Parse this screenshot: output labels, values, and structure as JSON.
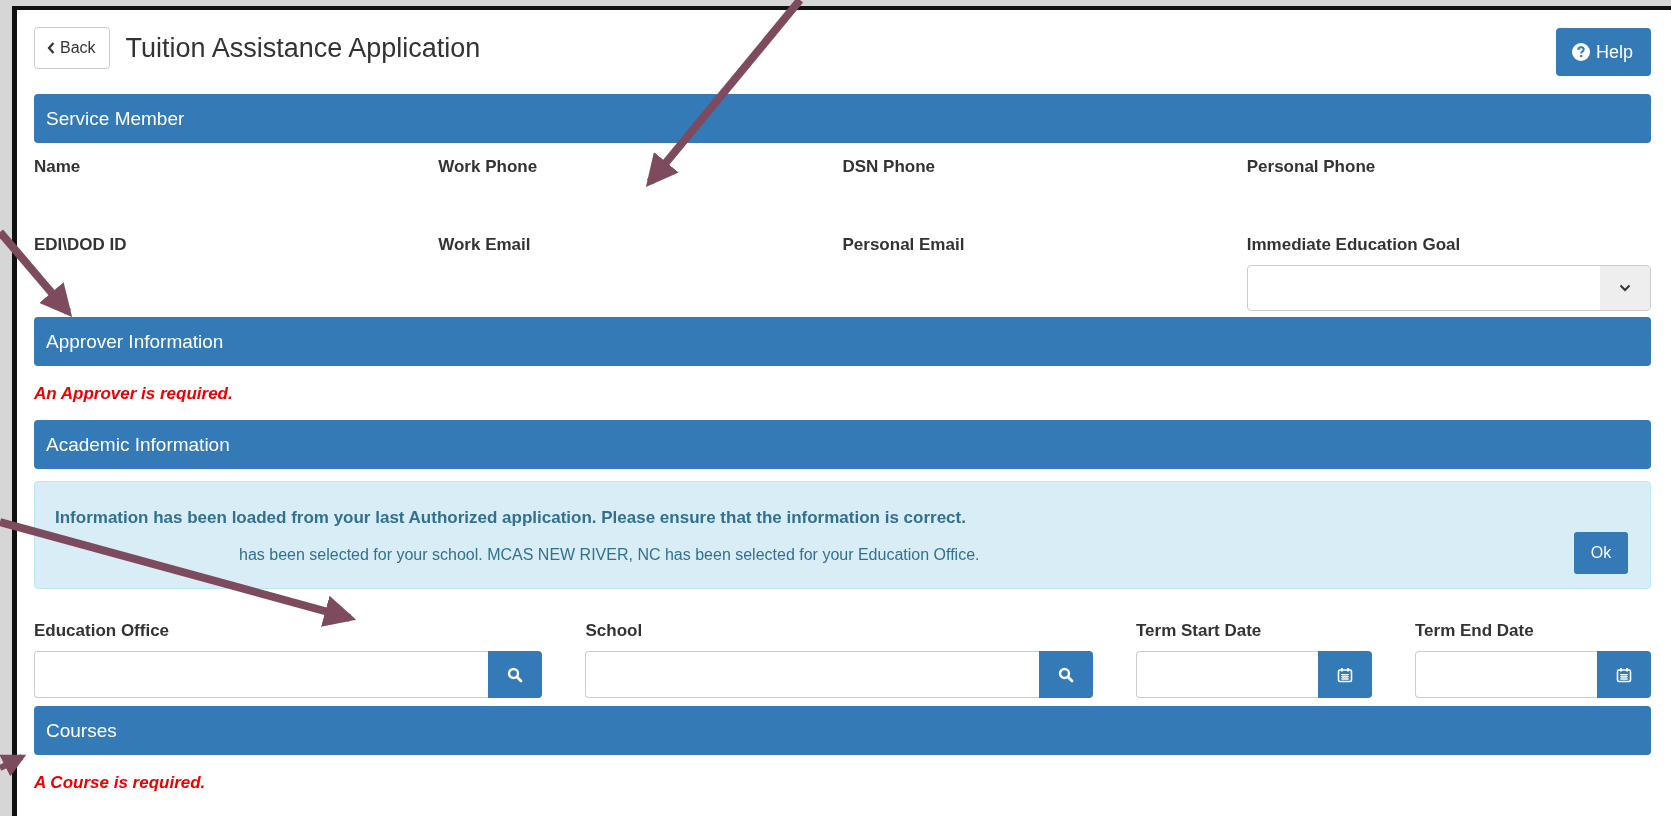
{
  "header": {
    "back_button": "Back",
    "title": "Tuition Assistance Application",
    "help_button": "Help"
  },
  "service_member": {
    "title": "Service Member",
    "fields": [
      {
        "label": "Name",
        "kind": "text"
      },
      {
        "label": "Work Phone",
        "kind": "text"
      },
      {
        "label": "DSN Phone",
        "kind": "text"
      },
      {
        "label": "Personal Phone",
        "kind": "text"
      },
      {
        "label": "EDI\\DOD ID",
        "kind": "text"
      },
      {
        "label": "Work Email",
        "kind": "text"
      },
      {
        "label": "Personal Email",
        "kind": "text"
      },
      {
        "label": "Immediate Education Goal",
        "kind": "select"
      }
    ]
  },
  "approver": {
    "title": "Approver Information",
    "error": "An Approver is required."
  },
  "academic": {
    "title": "Academic Information",
    "alert": {
      "heading": "Information has been loaded from your last Authorized application. Please ensure that the information is correct.",
      "message": "has been selected for your school. MCAS NEW RIVER, NC has been selected for your Education Office.",
      "button": "Ok"
    },
    "fields": [
      {
        "label": "Education Office",
        "kind": "search"
      },
      {
        "label": "School",
        "kind": "search"
      },
      {
        "label": "Term Start Date",
        "kind": "date"
      },
      {
        "label": "Term End Date",
        "kind": "date"
      }
    ]
  },
  "courses": {
    "title": "Courses",
    "error": "A Course is required."
  }
}
